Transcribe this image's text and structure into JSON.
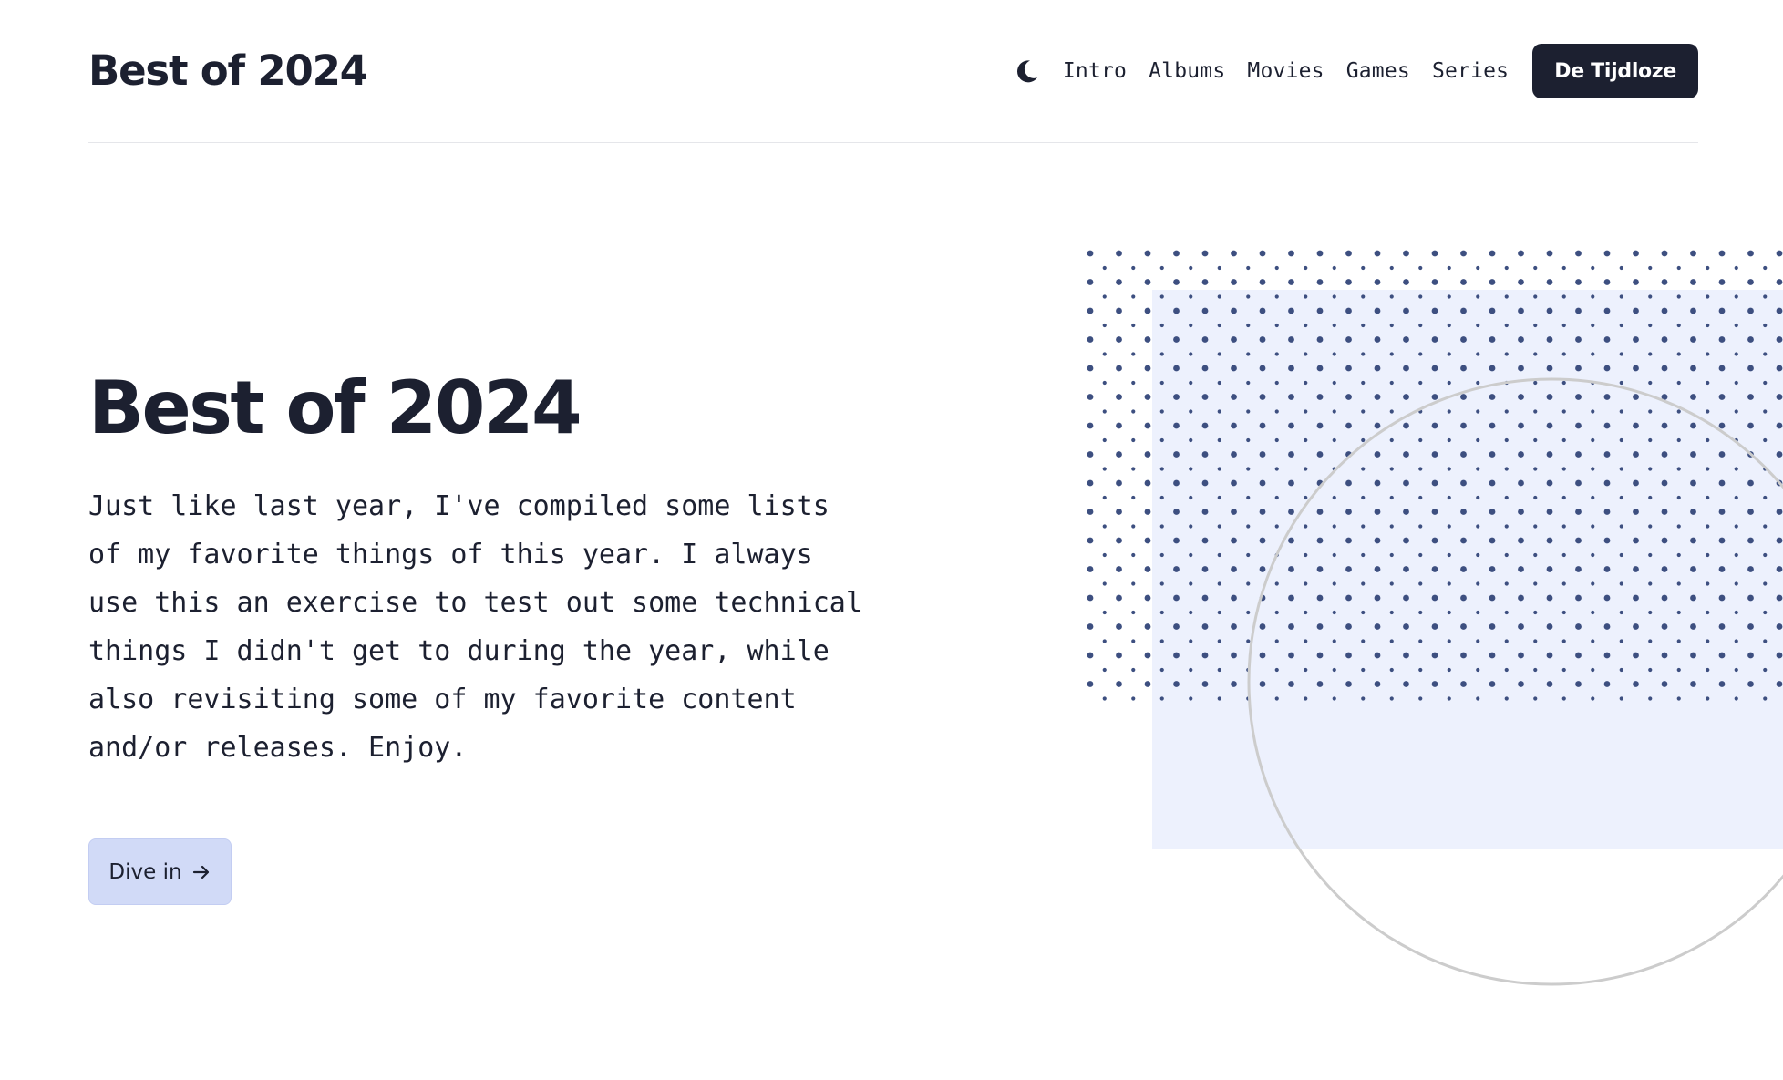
{
  "header": {
    "brand": "Best of 2024",
    "theme_toggle_icon": "moon-icon",
    "nav": [
      {
        "label": "Intro"
      },
      {
        "label": "Albums"
      },
      {
        "label": "Movies"
      },
      {
        "label": "Games"
      },
      {
        "label": "Series"
      }
    ],
    "cta_label": "De Tijdloze"
  },
  "hero": {
    "title": "Best of 2024",
    "intro": "Just like last year, I've compiled some lists of my favorite things of this year. I always use this an exercise to test out some technical things I didn't get to during the year, while also revisiting some of my favorite content and/or releases. Enjoy.",
    "button_label": "Dive in",
    "button_icon": "arrow-right-icon"
  },
  "colors": {
    "text": "#1c2030",
    "accent_button_bg": "#d1daf7",
    "panel_bg": "#edf1fd",
    "dot": "#3d4f80",
    "circle_stroke": "#cccccc",
    "divider": "#e5e6ea"
  }
}
